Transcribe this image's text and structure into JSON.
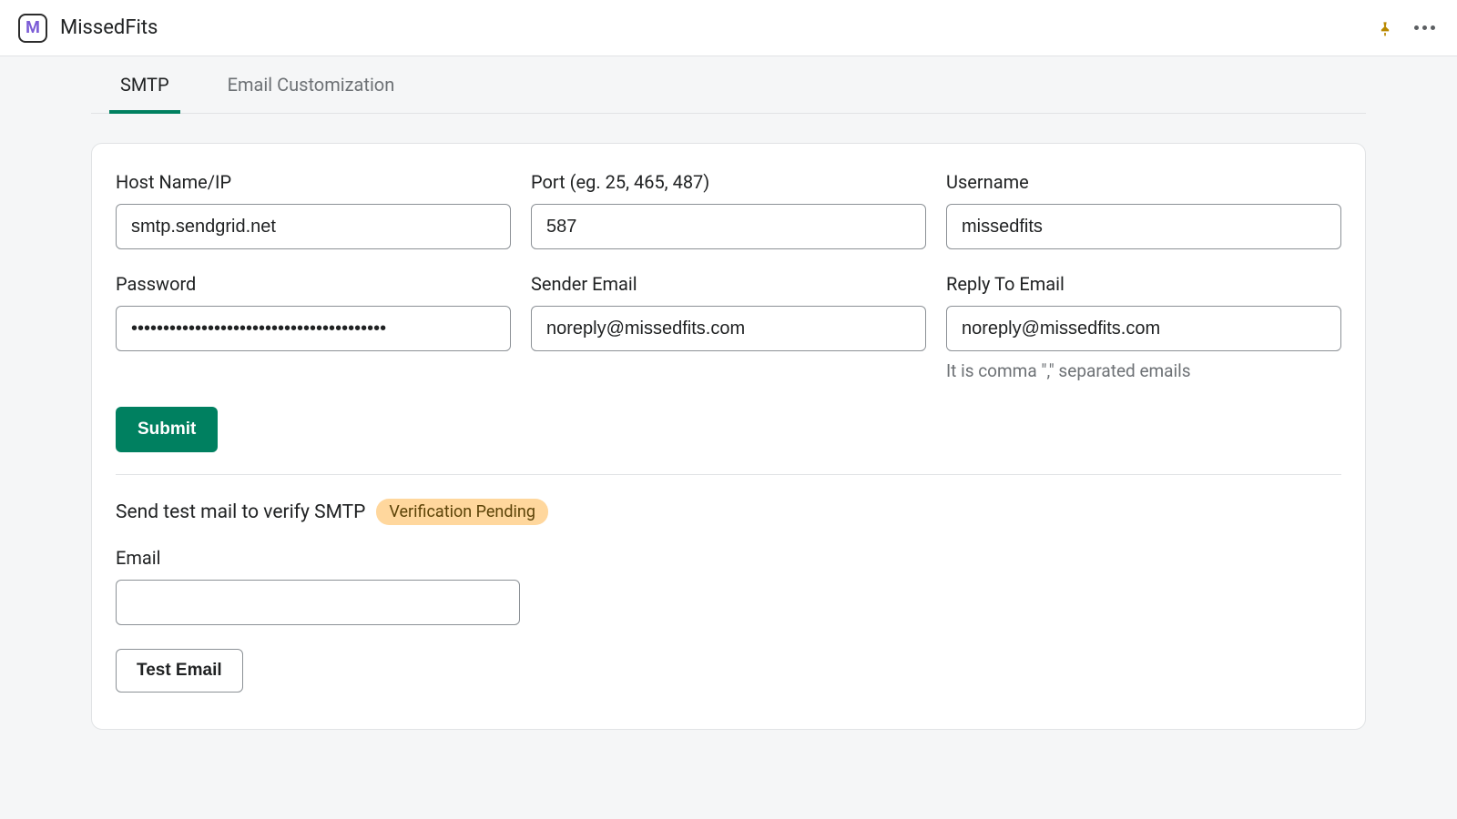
{
  "header": {
    "app_name": "MissedFits",
    "logo_letter": "M"
  },
  "tabs": [
    {
      "label": "SMTP",
      "active": true
    },
    {
      "label": "Email Customization",
      "active": false
    }
  ],
  "form": {
    "host": {
      "label": "Host Name/IP",
      "value": "smtp.sendgrid.net"
    },
    "port": {
      "label": "Port (eg. 25, 465, 487)",
      "value": "587"
    },
    "username": {
      "label": "Username",
      "value": "missedfits"
    },
    "password": {
      "label": "Password",
      "value": "••••••••••••••••••••••••••••••••••••••••"
    },
    "sender_email": {
      "label": "Sender Email",
      "value": "noreply@missedfits.com"
    },
    "reply_to": {
      "label": "Reply To Email",
      "value": "noreply@missedfits.com",
      "help": "It is comma \",\" separated emails"
    },
    "submit_label": "Submit"
  },
  "verify": {
    "heading": "Send test mail to verify SMTP",
    "badge": "Verification Pending",
    "email_label": "Email",
    "email_value": "",
    "test_button_label": "Test Email"
  },
  "colors": {
    "primary": "#008060",
    "badge_bg": "#ffd79d",
    "pin": "#b98900"
  }
}
